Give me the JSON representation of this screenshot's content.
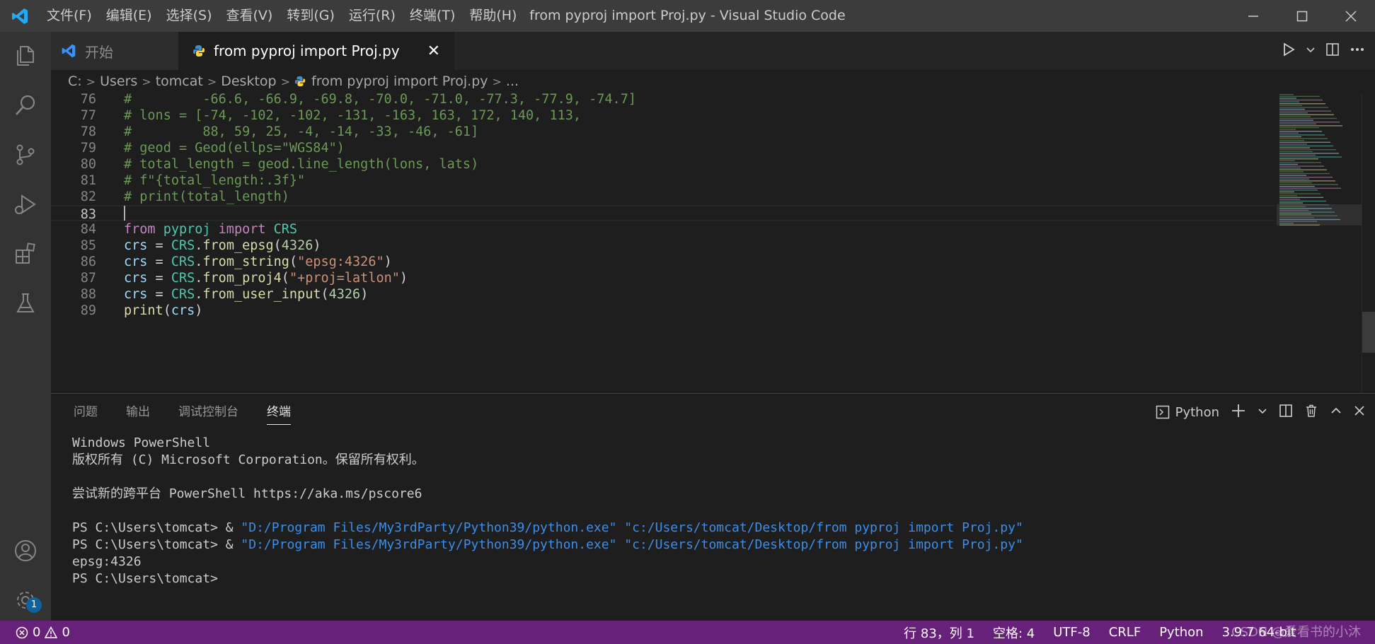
{
  "window": {
    "title": "from pyproj import Proj.py - Visual Studio Code",
    "menu": [
      "文件(F)",
      "编辑(E)",
      "选择(S)",
      "查看(V)",
      "转到(G)",
      "运行(R)",
      "终端(T)",
      "帮助(H)"
    ]
  },
  "tabs": {
    "welcome": "开始",
    "active": "from pyproj import Proj.py",
    "close_glyph": "✕"
  },
  "breadcrumb": [
    "C:",
    "Users",
    "tomcat",
    "Desktop",
    "from pyproj import Proj.py",
    "..."
  ],
  "editor": {
    "lines": [
      {
        "n": "76",
        "tokens": [
          {
            "t": "#         -66.6, -66.9, -69.8, -70.0, -71.0, -77.3, -77.9, -74.7]",
            "c": "com"
          }
        ]
      },
      {
        "n": "77",
        "tokens": [
          {
            "t": "# lons = [-74, -102, -102, -131, -163, 163, 172, 140, 113,",
            "c": "com"
          }
        ]
      },
      {
        "n": "78",
        "tokens": [
          {
            "t": "#         88, 59, 25, -4, -14, -33, -46, -61]",
            "c": "com"
          }
        ]
      },
      {
        "n": "79",
        "tokens": [
          {
            "t": "# geod = Geod(ellps=\"WGS84\")",
            "c": "com"
          }
        ]
      },
      {
        "n": "80",
        "tokens": [
          {
            "t": "# total_length = geod.line_length(lons, lats)",
            "c": "com"
          }
        ]
      },
      {
        "n": "81",
        "tokens": [
          {
            "t": "# f\"{total_length:.3f}\"",
            "c": "com"
          }
        ]
      },
      {
        "n": "82",
        "tokens": [
          {
            "t": "# print(total_length)",
            "c": "com"
          }
        ]
      },
      {
        "n": "83",
        "tokens": []
      },
      {
        "n": "84",
        "tokens": [
          {
            "t": "from",
            "c": "kw"
          },
          {
            "t": " ",
            "c": "def"
          },
          {
            "t": "pyproj",
            "c": "cls"
          },
          {
            "t": " ",
            "c": "def"
          },
          {
            "t": "import",
            "c": "kw"
          },
          {
            "t": " ",
            "c": "def"
          },
          {
            "t": "CRS",
            "c": "cls"
          }
        ]
      },
      {
        "n": "85",
        "tokens": [
          {
            "t": "crs",
            "c": "var"
          },
          {
            "t": " = ",
            "c": "def"
          },
          {
            "t": "CRS",
            "c": "cls"
          },
          {
            "t": ".",
            "c": "def"
          },
          {
            "t": "from_epsg",
            "c": "fn"
          },
          {
            "t": "(",
            "c": "def"
          },
          {
            "t": "4326",
            "c": "num"
          },
          {
            "t": ")",
            "c": "def"
          }
        ]
      },
      {
        "n": "86",
        "tokens": [
          {
            "t": "crs",
            "c": "var"
          },
          {
            "t": " = ",
            "c": "def"
          },
          {
            "t": "CRS",
            "c": "cls"
          },
          {
            "t": ".",
            "c": "def"
          },
          {
            "t": "from_string",
            "c": "fn"
          },
          {
            "t": "(",
            "c": "def"
          },
          {
            "t": "\"epsg:4326\"",
            "c": "str"
          },
          {
            "t": ")",
            "c": "def"
          }
        ]
      },
      {
        "n": "87",
        "tokens": [
          {
            "t": "crs",
            "c": "var"
          },
          {
            "t": " = ",
            "c": "def"
          },
          {
            "t": "CRS",
            "c": "cls"
          },
          {
            "t": ".",
            "c": "def"
          },
          {
            "t": "from_proj4",
            "c": "fn"
          },
          {
            "t": "(",
            "c": "def"
          },
          {
            "t": "\"+proj=latlon\"",
            "c": "str"
          },
          {
            "t": ")",
            "c": "def"
          }
        ]
      },
      {
        "n": "88",
        "tokens": [
          {
            "t": "crs",
            "c": "var"
          },
          {
            "t": " = ",
            "c": "def"
          },
          {
            "t": "CRS",
            "c": "cls"
          },
          {
            "t": ".",
            "c": "def"
          },
          {
            "t": "from_user_input",
            "c": "fn"
          },
          {
            "t": "(",
            "c": "def"
          },
          {
            "t": "4326",
            "c": "num"
          },
          {
            "t": ")",
            "c": "def"
          }
        ]
      },
      {
        "n": "89",
        "tokens": [
          {
            "t": "print",
            "c": "fn"
          },
          {
            "t": "(",
            "c": "def"
          },
          {
            "t": "crs",
            "c": "var"
          },
          {
            "t": ")",
            "c": "def"
          }
        ]
      }
    ],
    "current_line": "83"
  },
  "panel": {
    "tabs": [
      "问题",
      "输出",
      "调试控制台",
      "终端"
    ],
    "active_tab": "终端",
    "terminal_selector": "Python",
    "terminal_lines": [
      [
        {
          "t": "Windows PowerShell",
          "c": "def"
        }
      ],
      [
        {
          "t": "版权所有 (C) Microsoft Corporation。保留所有权利。",
          "c": "def"
        }
      ],
      [],
      [
        {
          "t": "尝试新的跨平台 PowerShell https://aka.ms/pscore6",
          "c": "def"
        }
      ],
      [],
      [
        {
          "t": "PS C:\\Users\\tomcat> & ",
          "c": "def"
        },
        {
          "t": "\"D:/Program Files/My3rdParty/Python39/python.exe\" \"c:/Users/tomcat/Desktop/from pyproj import Proj.py\"",
          "c": "str"
        }
      ],
      [
        {
          "t": "PS C:\\Users\\tomcat> & ",
          "c": "def"
        },
        {
          "t": "\"D:/Program Files/My3rdParty/Python39/python.exe\" \"c:/Users/tomcat/Desktop/from pyproj import Proj.py\"",
          "c": "str"
        }
      ],
      [
        {
          "t": "epsg:4326",
          "c": "def"
        }
      ],
      [
        {
          "t": "PS C:\\Users\\tomcat>",
          "c": "def"
        }
      ]
    ]
  },
  "activity": {
    "accounts_badge": "1"
  },
  "status": {
    "errors": "0",
    "warnings": "0",
    "position": "行 83，列 1",
    "indent": "空格: 4",
    "encoding": "UTF-8",
    "eol": "CRLF",
    "language": "Python",
    "interpreter": "3.9.7 64-bit",
    "watermark": "CSDN @爱看书的小沐"
  },
  "colors": {
    "statusbar": "#68217a",
    "accent": "#0e639c",
    "comment": "#6a9955",
    "keyword": "#c586c0",
    "class": "#4ec9b0",
    "string": "#ce9178"
  }
}
